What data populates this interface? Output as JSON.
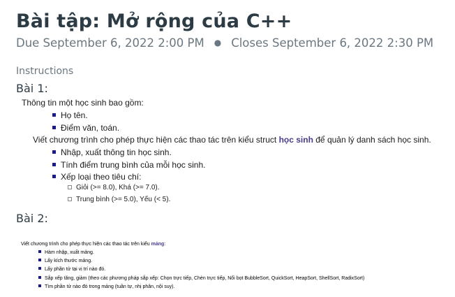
{
  "header": {
    "title": "Bài tập: Mở rộng của C++",
    "due": "Due September 6, 2022 2:00 PM",
    "separator": "●",
    "closes": "Closes September 6, 2022 2:30 PM"
  },
  "instructions": {
    "label": "Instructions",
    "bai1": {
      "heading": "Bài 1:",
      "intro": "Thông tin một học sinh bao gồm:",
      "fields": [
        "Họ tên.",
        "Điểm văn, toán."
      ],
      "task_before": "Viết chương trình cho phép thực hiện các thao tác trên kiểu struct ",
      "task_keyword": "học sinh",
      "task_after": " để quản lý danh sách học sinh.",
      "tasks": [
        "Nhập, xuất thông tin học sinh.",
        "Tính điểm trung bình của mỗi học sinh.",
        "Xếp loại theo tiêu chí:"
      ],
      "criteria": [
        "Giỏi (>= 8.0), Khá (>= 7.0).",
        "Trung bình (>= 5.0), Yếu (< 5)."
      ]
    },
    "bai2": {
      "heading": "Bài 2:",
      "intro_before": "Viết chương trình cho phép thực hiện các thao tác trên kiểu ",
      "intro_keyword": "mảng",
      "intro_after": ":",
      "tasks": [
        "Hàm nhập, xuất mảng.",
        "Lấy kích thước mảng.",
        "Lấy phần tử tại vị trí nào đó.",
        "Sắp xếp tăng, giảm (theo các phương pháp sắp xếp: Chọn trực tiếp, Chèn trực tiếp, Nổi bọt BubbleSort, QuickSort, HeapSort, ShellSort, RadixSort)",
        "Tìm phần tử nào đó trong mảng (tuần tự, nhị phân, nội suy)."
      ]
    }
  },
  "colors": {
    "title": "#2d3b45",
    "muted": "#6b7780",
    "bullet": "#1a1a8c",
    "keyword": "#4a3a8a"
  }
}
